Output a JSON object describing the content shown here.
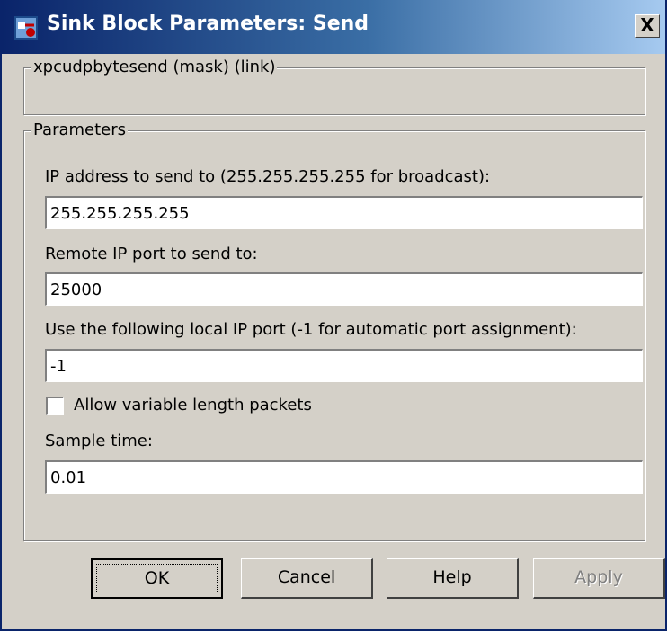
{
  "window": {
    "title": "Sink Block Parameters: Send",
    "close_label": "X"
  },
  "description_group": {
    "legend": "xpcudpbytesend (mask) (link)"
  },
  "parameters_group": {
    "legend": "Parameters",
    "ip_address": {
      "label": "IP address to send to (255.255.255.255 for broadcast):",
      "value": "255.255.255.255"
    },
    "remote_port": {
      "label": "Remote IP port to send to:",
      "value": "25000"
    },
    "local_port": {
      "label": "Use the following local IP port (-1 for automatic port assignment):",
      "value": "-1"
    },
    "variable_length": {
      "label": "Allow variable length packets",
      "checked": false
    },
    "sample_time": {
      "label": "Sample time:",
      "value": "0.01"
    }
  },
  "buttons": {
    "ok": "OK",
    "cancel": "Cancel",
    "help": "Help",
    "apply": "Apply"
  }
}
